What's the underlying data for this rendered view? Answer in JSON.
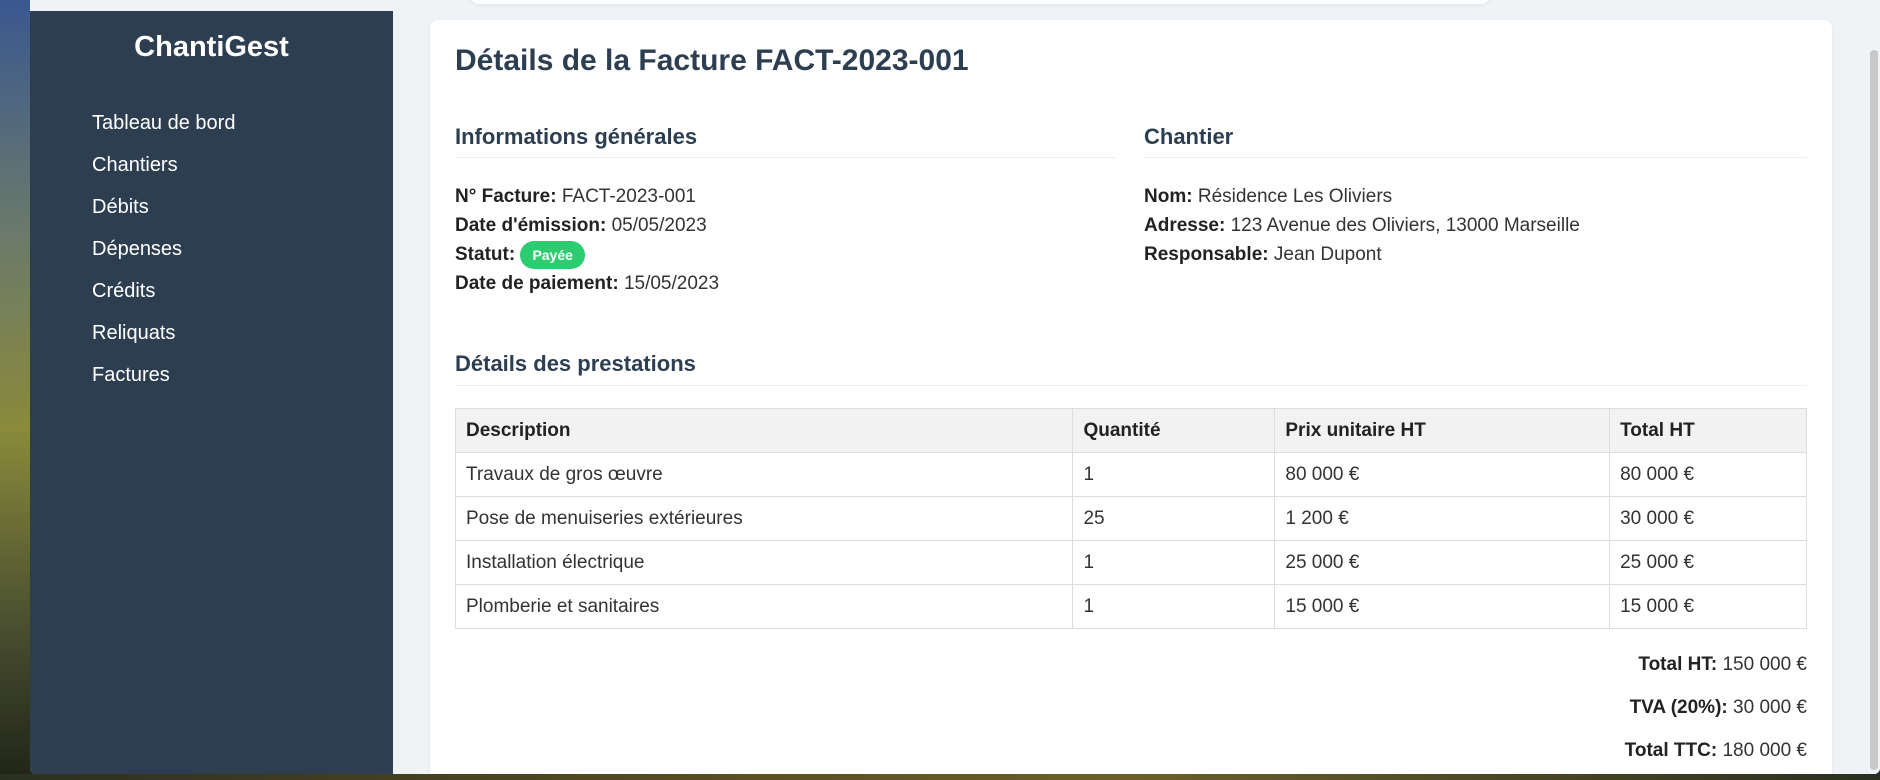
{
  "app": {
    "brand": "ChantiGest"
  },
  "sidebar": {
    "items": [
      {
        "label": "Tableau de bord"
      },
      {
        "label": "Chantiers"
      },
      {
        "label": "Débits"
      },
      {
        "label": "Dépenses"
      },
      {
        "label": "Crédits"
      },
      {
        "label": "Reliquats"
      },
      {
        "label": "Factures"
      }
    ]
  },
  "page": {
    "title": "Détails de la Facture FACT-2023-001"
  },
  "general": {
    "title": "Informations générales",
    "invoice_no_label": "N° Facture:",
    "invoice_no": "FACT-2023-001",
    "issue_date_label": "Date d'émission:",
    "issue_date": "05/05/2023",
    "status_label": "Statut:",
    "status": "Payée",
    "payment_date_label": "Date de paiement:",
    "payment_date": "15/05/2023"
  },
  "site": {
    "title": "Chantier",
    "name_label": "Nom:",
    "name": "Résidence Les Oliviers",
    "address_label": "Adresse:",
    "address": "123 Avenue des Oliviers, 13000 Marseille",
    "manager_label": "Responsable:",
    "manager": "Jean Dupont"
  },
  "prestations": {
    "title": "Détails des prestations",
    "columns": [
      "Description",
      "Quantité",
      "Prix unitaire HT",
      "Total HT"
    ],
    "rows": [
      [
        "Travaux de gros œuvre",
        "1",
        "80 000 €",
        "80 000 €"
      ],
      [
        "Pose de menuiseries extérieures",
        "25",
        "1 200 €",
        "30 000 €"
      ],
      [
        "Installation électrique",
        "1",
        "25 000 €",
        "25 000 €"
      ],
      [
        "Plomberie et sanitaires",
        "1",
        "15 000 €",
        "15 000 €"
      ]
    ]
  },
  "totals": {
    "ht_label": "Total HT:",
    "ht": "150 000 €",
    "tva_label": "TVA (20%):",
    "tva": "30 000 €",
    "ttc_label": "Total TTC:",
    "ttc": "180 000 €"
  },
  "colors": {
    "sidebar_bg": "#2c3e50",
    "badge_paid": "#2ecc71",
    "page_bg": "#f0f3f6"
  }
}
